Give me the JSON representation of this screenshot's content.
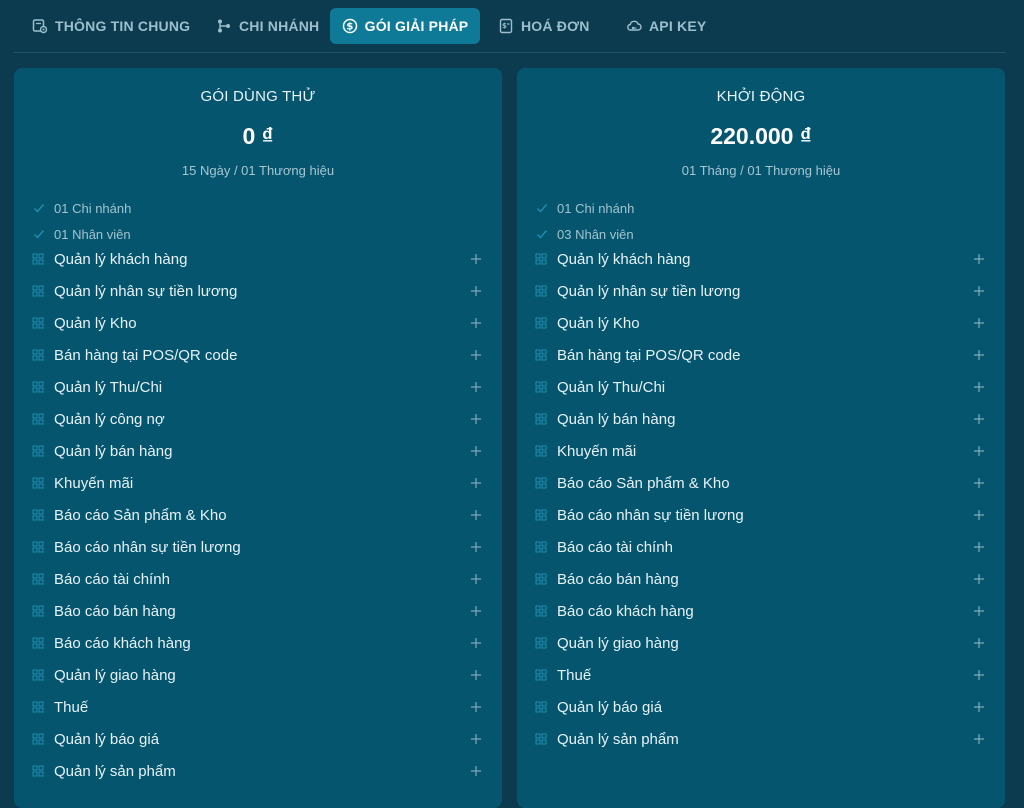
{
  "tabs": [
    {
      "label": "THÔNG TIN CHUNG",
      "icon": "settings-doc-icon",
      "active": false
    },
    {
      "label": "CHI NHÁNH",
      "icon": "branch-icon",
      "active": false
    },
    {
      "label": "GÓI GIẢI PHÁP",
      "icon": "dollar-cycle-icon",
      "active": true
    },
    {
      "label": "HOÁ ĐƠN",
      "icon": "invoice-icon",
      "active": false
    },
    {
      "label": "API KEY",
      "icon": "cloud-key-icon",
      "active": false
    }
  ],
  "plans": [
    {
      "name": "GÓI DÙNG THỬ",
      "price": "0 ₫",
      "period": "15 Ngày / 01 Thương hiệu",
      "limits": [
        "01 Chi nhánh",
        "01 Nhân viên"
      ],
      "features": [
        "Quản lý khách hàng",
        "Quản lý nhân sự tiền lương",
        "Quản lý Kho",
        "Bán hàng tại POS/QR code",
        "Quản lý Thu/Chi",
        "Quản lý công nợ",
        "Quản lý bán hàng",
        "Khuyến mãi",
        "Báo cáo Sản phẩm & Kho",
        "Báo cáo nhân sự tiền lương",
        "Báo cáo tài chính",
        "Báo cáo bán hàng",
        "Báo cáo khách hàng",
        "Quản lý giao hàng",
        "Thuế",
        "Quản lý báo giá",
        "Quản lý sản phẩm"
      ]
    },
    {
      "name": "KHỞI ĐỘNG",
      "price": "220.000 ₫",
      "period": "01 Tháng / 01 Thương hiệu",
      "limits": [
        "01 Chi nhánh",
        "03 Nhân viên"
      ],
      "features": [
        "Quản lý khách hàng",
        "Quản lý nhân sự tiền lương",
        "Quản lý Kho",
        "Bán hàng tại POS/QR code",
        "Quản lý Thu/Chi",
        "Quản lý bán hàng",
        "Khuyến mãi",
        "Báo cáo Sản phẩm & Kho",
        "Báo cáo nhân sự tiền lương",
        "Báo cáo tài chính",
        "Báo cáo bán hàng",
        "Báo cáo khách hàng",
        "Quản lý giao hàng",
        "Thuế",
        "Quản lý báo giá",
        "Quản lý sản phẩm"
      ]
    }
  ],
  "colors": {
    "background": "#0c3b4f",
    "card": "#05556f",
    "active_tab": "#0f7a97",
    "accent_icon": "#1f8fae"
  }
}
